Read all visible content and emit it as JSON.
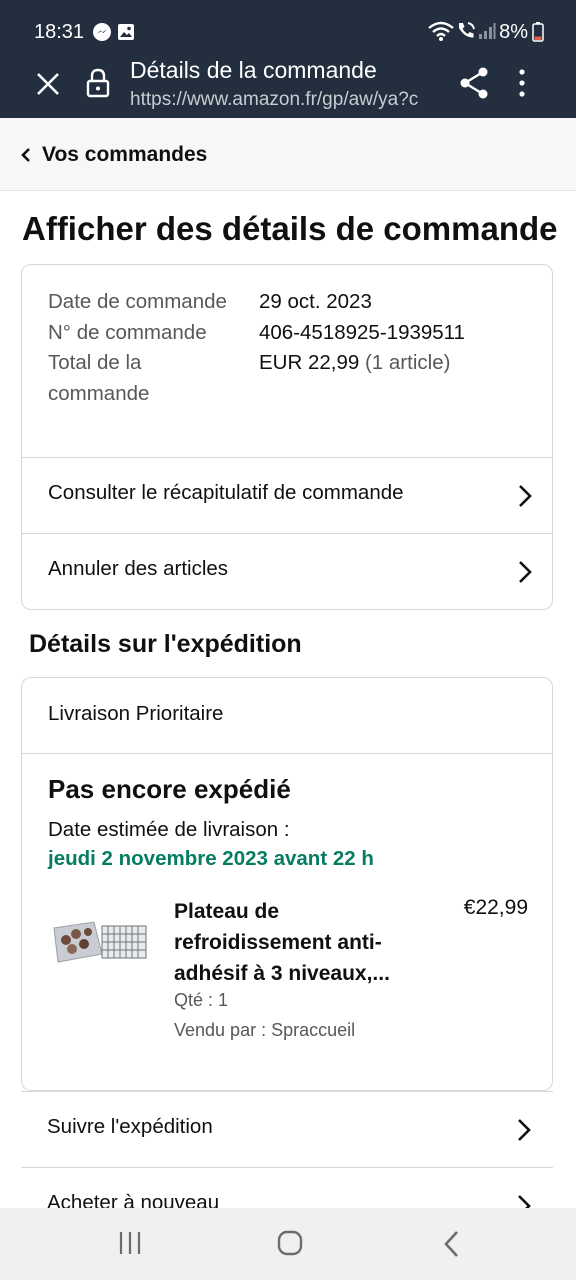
{
  "status_bar": {
    "time": "18:31",
    "battery": "8%",
    "icons": [
      "messenger-icon",
      "gallery-icon",
      "wifi-icon",
      "call-icon",
      "signal-icon",
      "battery-icon"
    ]
  },
  "browser": {
    "page_title": "Détails de la commande",
    "url": "https://www.amazon.fr/gp/aw/ya?c",
    "icons": [
      "close-icon",
      "lock-icon",
      "share-icon",
      "more-icon"
    ]
  },
  "breadcrumb": {
    "label": "Vos commandes"
  },
  "page": {
    "title": "Afficher des détails de commande"
  },
  "order_summary": {
    "date_label": "Date de commande",
    "date_value": "29 oct. 2023",
    "number_label": "N° de commande",
    "number_value": "406-4518925-1939511",
    "total_label": "Total de la commande",
    "total_value": "EUR 22,99",
    "total_count": "(1 article)",
    "link_recap": "Consulter le récapitulatif de commande",
    "link_cancel": "Annuler des articles"
  },
  "shipping": {
    "section_title": "Détails sur l'expédition",
    "method": "Livraison Prioritaire",
    "status": "Pas encore expédié",
    "estimated_label": "Date estimée de livraison :",
    "estimated_date": "jeudi 2 novembre 2023 avant 22 h",
    "item": {
      "title": "Plateau de refroidissement anti-adhésif à 3 niveaux,...",
      "price": "€22,99",
      "quantity": "Qté : 1",
      "seller": "Vendu par : Spraccueil"
    }
  },
  "actions": {
    "track": "Suivre l'expédition",
    "buy_again": "Acheter à nouveau"
  },
  "colors": {
    "header_bg": "#232f3e",
    "delivery_green": "#067d62",
    "border": "#d5d9d9"
  }
}
